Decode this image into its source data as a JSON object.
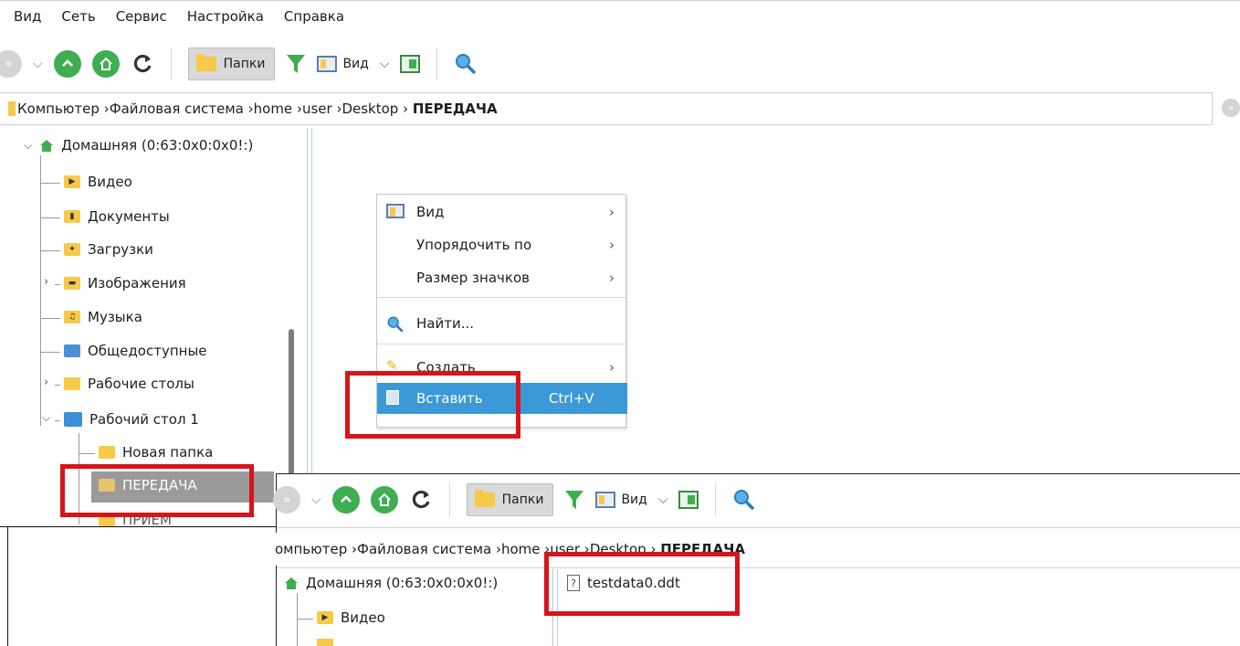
{
  "menu": [
    "Вид",
    "Сеть",
    "Сервис",
    "Настройка",
    "Справка"
  ],
  "toolbar": {
    "folders_label": "Папки",
    "view_label": "Вид"
  },
  "address": {
    "crumbs": [
      "Компьютер",
      "Файловая система",
      "home",
      "user",
      "Desktop"
    ],
    "current": "ПЕРЕДАЧА"
  },
  "tree": {
    "root": "Домашняя (0:63:0x0:0x0!:)",
    "items": [
      "Видео",
      "Документы",
      "Загрузки",
      "Изображения",
      "Музыка",
      "Общедоступные",
      "Рабочие столы",
      "Рабочий стол 1",
      "Новая папка",
      "ПЕРЕДАЧА",
      "ПРИЕМ"
    ]
  },
  "context_menu": {
    "view": "Вид",
    "sort_by": "Упорядочить по",
    "icon_size": "Размер значков",
    "find": "Найти...",
    "create": "Создать",
    "paste": "Вставить",
    "paste_shortcut": "Ctrl+V"
  },
  "overlay": {
    "toolbar": {
      "folders_label": "Папки",
      "view_label": "Вид"
    },
    "address": {
      "crumbs_partial": "омпьютер",
      "crumbs": [
        "Файловая система",
        "home",
        "user",
        "Desktop"
      ],
      "current": "ПЕРЕДАЧА"
    },
    "tree_root": "Домашняя (0:63:0x0:0x0!:)",
    "tree_items": [
      "Видео"
    ],
    "file": "testdata0.ddt"
  },
  "colors": {
    "highlight": "#3b99d8",
    "annotation_red": "#d8141b",
    "green_button": "#3fae50",
    "folder_yellow": "#f7c948"
  }
}
